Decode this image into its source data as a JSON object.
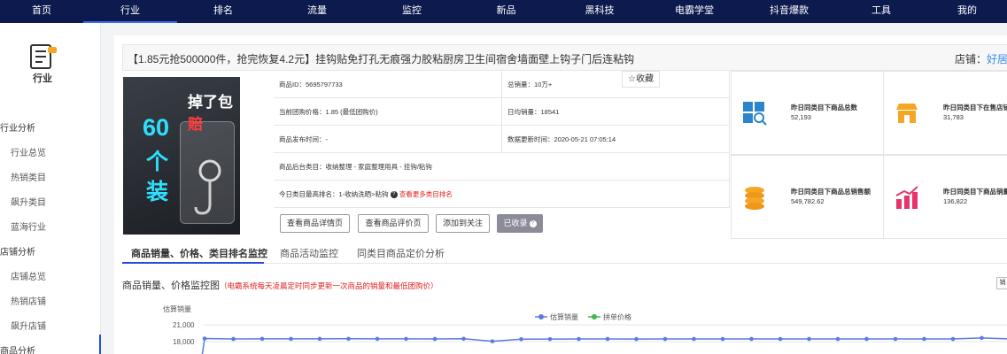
{
  "nav": {
    "items": [
      "首页",
      "行业",
      "排名",
      "流量",
      "监控",
      "新品",
      "黑科技",
      "电霸学堂",
      "抖音爆款",
      "工具",
      "我的"
    ],
    "active_index": 1
  },
  "sidebar": {
    "title": "行业",
    "groups": [
      {
        "label": "行业分析",
        "items": [
          "行业总览",
          "热销类目",
          "飙升类目",
          "蓝海行业"
        ]
      },
      {
        "label": "店铺分析",
        "items": [
          "店铺总览",
          "热销店铺",
          "飙升店铺"
        ]
      },
      {
        "label": "商品分析",
        "items": []
      }
    ]
  },
  "product": {
    "title": "【1.85元抢500000件，抢完恢复4.2元】挂钩贴免打孔无痕强力胶粘厨房卫生间宿舍墙面壁上钩子门后连粘钩",
    "store_label": "店铺：",
    "store_name": "好居家",
    "image_text": {
      "top": "掉了包",
      "top_red": "赔",
      "num": "60",
      "ge": "个",
      "zhuang": "装"
    },
    "info": {
      "id": "商品ID：5695797733",
      "total_sales": "总销量：10万+",
      "price": "当前团购价格：1.85 (最低团购价)",
      "daily_sales": "日均销量：18541",
      "publish_time": "商品发布时间：-",
      "update_time": "数据更新时间：2020-05-21 07:05:14",
      "category": "商品后台类目：收纳整理 - 家庭整理用具 - 挂钩/粘钩",
      "rank_prefix": "今日类目最高排名：1-收纳洗晒>粘钩",
      "rank_link": "查看更多类目排名"
    },
    "fav_label": "☆收藏",
    "buttons": [
      "查看商品详情页",
      "查看商品评价页",
      "添加到关注",
      "已收录"
    ]
  },
  "stats": [
    {
      "label": "昨日同类目下商品总数",
      "value": "52,193",
      "icon": "grid-search-icon",
      "color": "#2a86c8"
    },
    {
      "label": "昨日同类目下在售店铺",
      "value": "31,783",
      "icon": "store-icon",
      "color": "#f5a623"
    },
    {
      "label": "昨日同类目下商品总销售额",
      "value": "549,782.62",
      "icon": "coins-icon",
      "color": "#f5a623"
    },
    {
      "label": "昨日同类目下商品销量",
      "value": "136,822",
      "icon": "bar-chart-icon",
      "color": "#e8336b"
    }
  ],
  "tabs": [
    "商品销量、价格、类目排名监控",
    "商品活动监控",
    "同类目商品定价分析"
  ],
  "chart_section": {
    "title": "商品销量、价格监控图",
    "note": "（电霸系统每天凌晨定时同步更新一次商品的销量和最低团购价）",
    "corner": "销"
  },
  "chart_data": {
    "type": "line",
    "ylabel": "估算销量",
    "y_ticks": [
      21000,
      18000
    ],
    "y_tick_labels": [
      "21,000",
      "18,000"
    ],
    "legend_position": "top-center",
    "series": [
      {
        "name": "估算销量",
        "color": "#5b7be0",
        "values": [
          18550,
          18480,
          18500,
          18490,
          18500,
          18510,
          18500,
          18490,
          18480,
          18510,
          18060,
          18430,
          18450,
          18470,
          18480,
          18460,
          18470,
          18480,
          18470,
          18480,
          18470,
          18480,
          18470,
          18480,
          18470,
          18480,
          18470,
          18650,
          18480,
          18490,
          18480
        ]
      },
      {
        "name": "拼单价格",
        "color": "#3cb94a",
        "values": []
      }
    ]
  }
}
